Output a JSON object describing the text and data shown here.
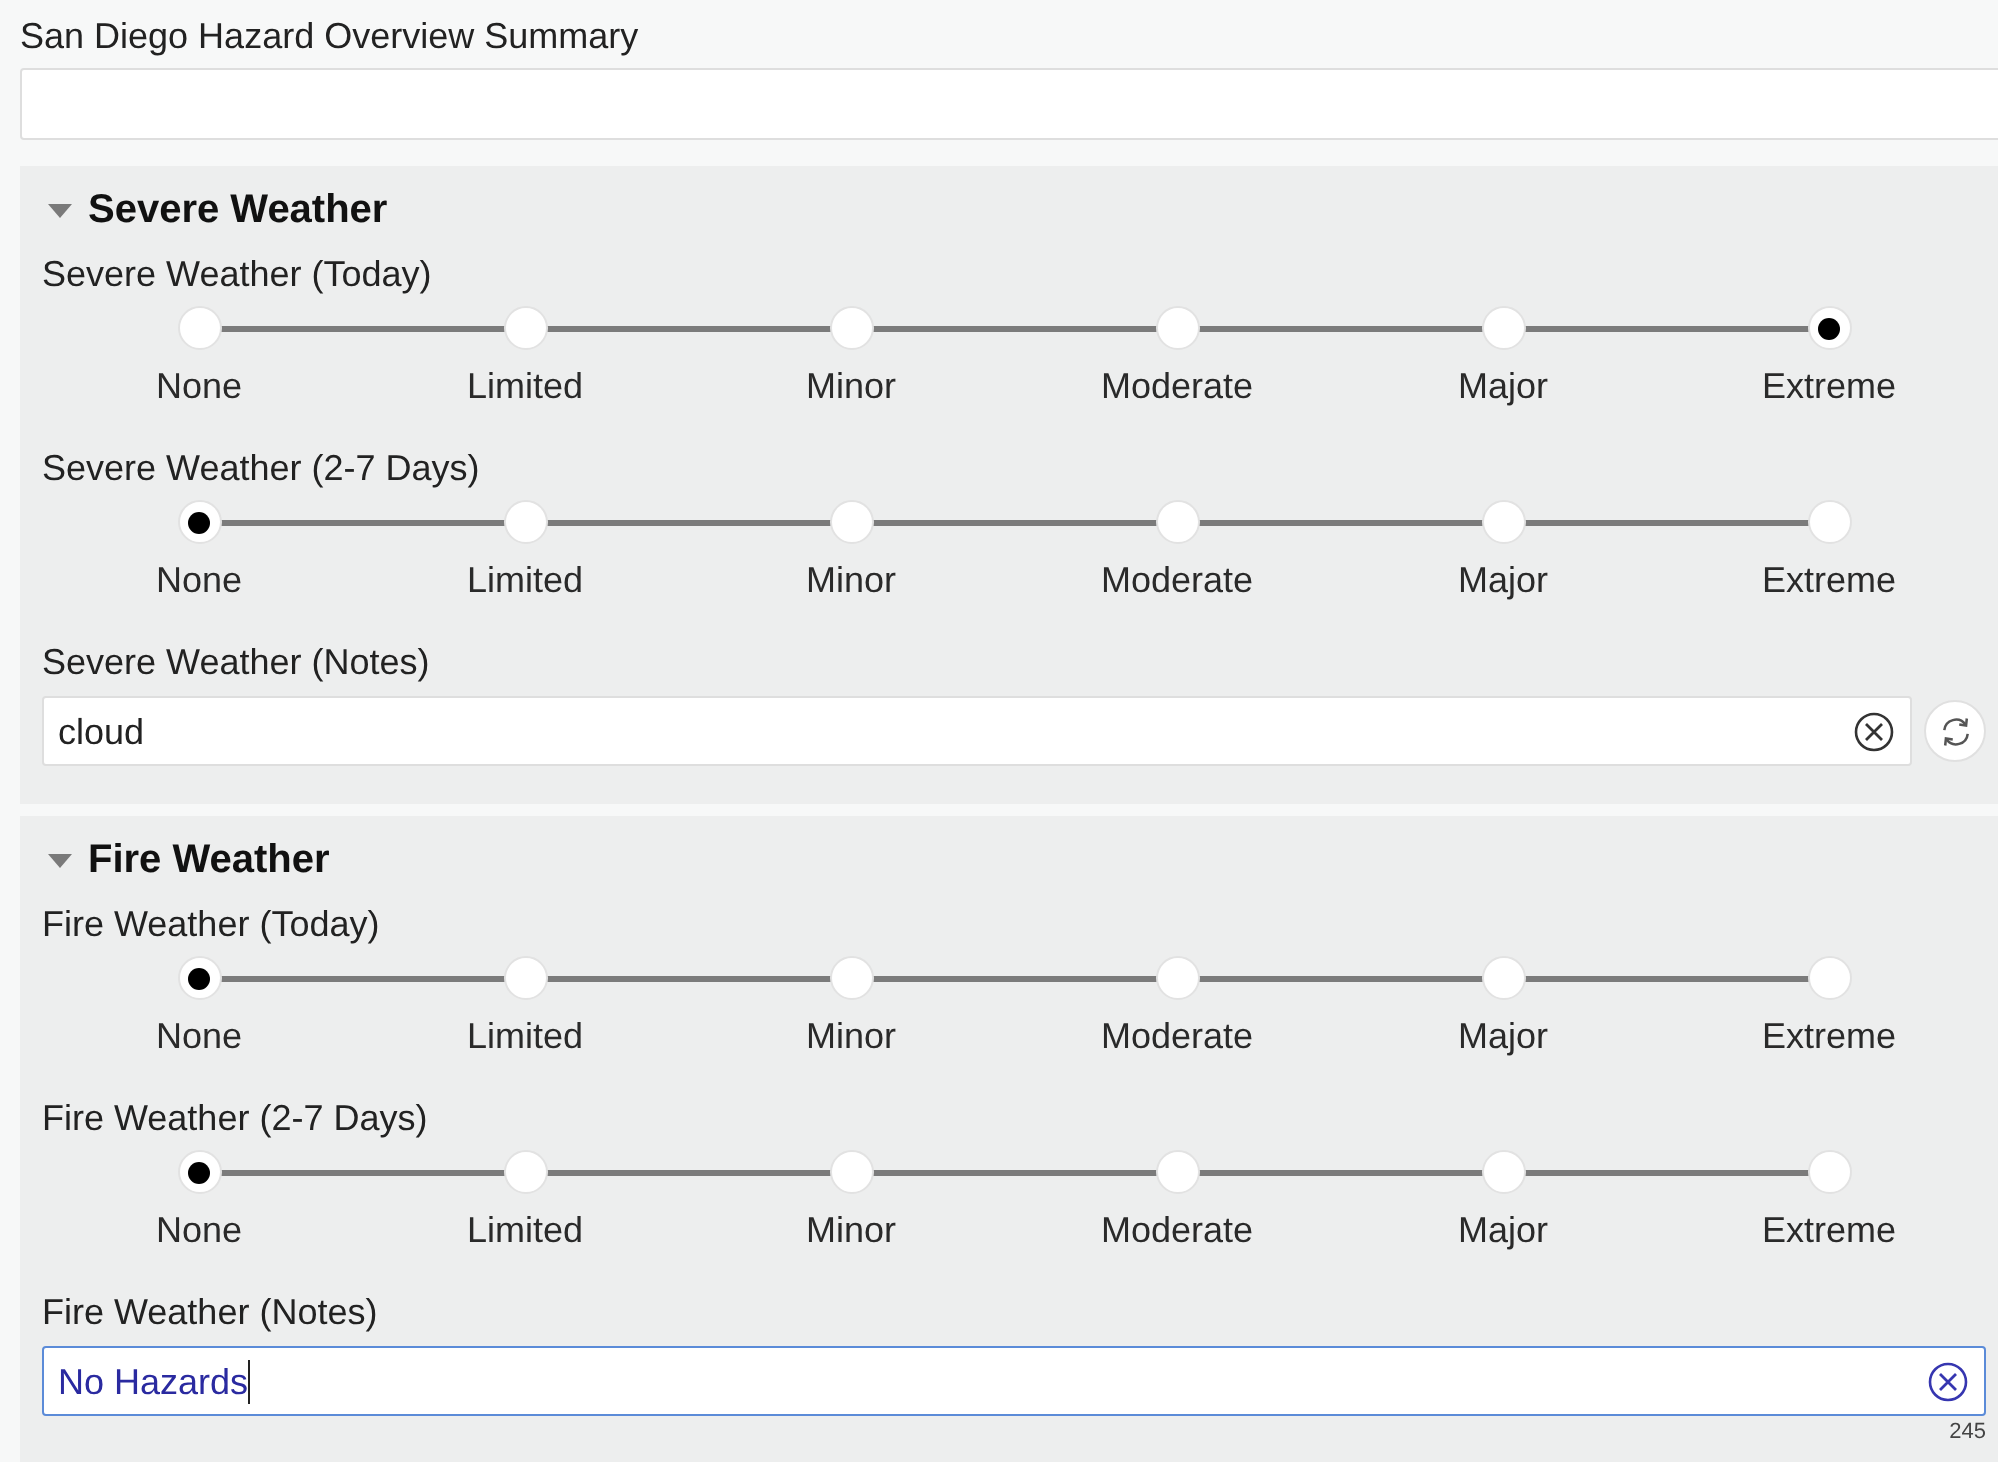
{
  "summary": {
    "label": "San Diego Hazard Overview Summary"
  },
  "sections": [
    {
      "title": "Severe Weather",
      "expanded": true,
      "fields": [
        {
          "kind": "scale",
          "label": "Severe Weather (Today)",
          "options": [
            {
              "label": "None",
              "selected": false
            },
            {
              "label": "Limited",
              "selected": false
            },
            {
              "label": "Minor",
              "selected": false
            },
            {
              "label": "Moderate",
              "selected": false
            },
            {
              "label": "Major",
              "selected": false
            },
            {
              "label": "Extreme",
              "selected": true
            }
          ]
        },
        {
          "kind": "scale",
          "label": "Severe Weather (2-7 Days)",
          "options": [
            {
              "label": "None",
              "selected": true
            },
            {
              "label": "Limited",
              "selected": false
            },
            {
              "label": "Minor",
              "selected": false
            },
            {
              "label": "Moderate",
              "selected": false
            },
            {
              "label": "Major",
              "selected": false
            },
            {
              "label": "Extreme",
              "selected": false
            }
          ]
        },
        {
          "kind": "notes",
          "label": "Severe Weather (Notes)",
          "value": "cloud",
          "focused": false,
          "refresh": true
        }
      ]
    },
    {
      "title": "Fire Weather",
      "expanded": true,
      "fields": [
        {
          "kind": "scale",
          "label": "Fire Weather (Today)",
          "options": [
            {
              "label": "None",
              "selected": true
            },
            {
              "label": "Limited",
              "selected": false
            },
            {
              "label": "Minor",
              "selected": false
            },
            {
              "label": "Moderate",
              "selected": false
            },
            {
              "label": "Major",
              "selected": false
            },
            {
              "label": "Extreme",
              "selected": false
            }
          ]
        },
        {
          "kind": "scale",
          "label": "Fire Weather (2-7 Days)",
          "options": [
            {
              "label": "None",
              "selected": true
            },
            {
              "label": "Limited",
              "selected": false
            },
            {
              "label": "Minor",
              "selected": false
            },
            {
              "label": "Moderate",
              "selected": false
            },
            {
              "label": "Major",
              "selected": false
            },
            {
              "label": "Extreme",
              "selected": false
            }
          ]
        },
        {
          "kind": "notes",
          "label": "Fire Weather (Notes)",
          "value": "No Hazards",
          "focused": true,
          "counter": "245"
        }
      ]
    }
  ]
}
